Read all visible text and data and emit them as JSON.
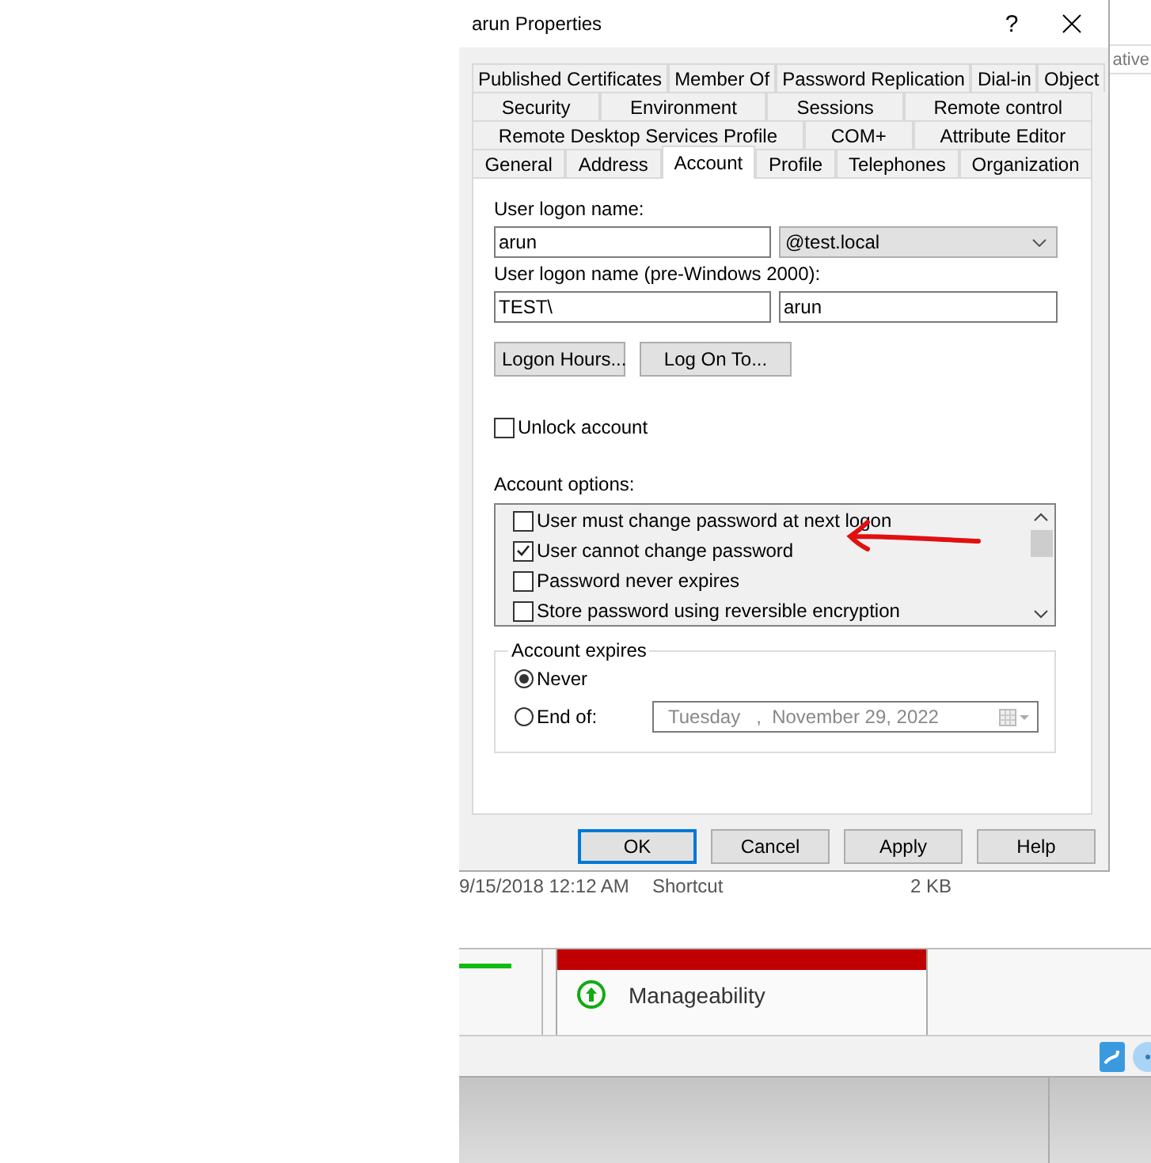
{
  "window": {
    "title": "arun Properties",
    "help": "?"
  },
  "tab_rows": [
    [
      {
        "label": "Published Certificates",
        "selected": false
      },
      {
        "label": "Member Of",
        "selected": false
      },
      {
        "label": "Password Replication",
        "selected": false
      },
      {
        "label": "Dial-in",
        "selected": false
      },
      {
        "label": "Object",
        "selected": false
      }
    ],
    [
      {
        "label": "Security",
        "selected": false
      },
      {
        "label": "Environment",
        "selected": false
      },
      {
        "label": "Sessions",
        "selected": false
      },
      {
        "label": "Remote control",
        "selected": false
      }
    ],
    [
      {
        "label": "Remote Desktop Services Profile",
        "selected": false
      },
      {
        "label": "COM+",
        "selected": false
      },
      {
        "label": "Attribute Editor",
        "selected": false
      }
    ],
    [
      {
        "label": "General",
        "selected": false
      },
      {
        "label": "Address",
        "selected": false
      },
      {
        "label": "Account",
        "selected": true
      },
      {
        "label": "Profile",
        "selected": false
      },
      {
        "label": "Telephones",
        "selected": false
      },
      {
        "label": "Organization",
        "selected": false
      }
    ]
  ],
  "logon_name": {
    "label": "User logon name:",
    "value": "arun",
    "domain": "@test.local"
  },
  "pre2000": {
    "label": "User logon name (pre-Windows 2000):",
    "domain": "TEST\\",
    "value": "arun"
  },
  "logon_buttons": [
    "Logon Hours...",
    "Log On To..."
  ],
  "unlock": {
    "label": "Unlock account",
    "checked": false
  },
  "account_options": {
    "label": "Account options:",
    "items": [
      {
        "label": "User must change password at next logon",
        "checked": false
      },
      {
        "label": "User cannot change password",
        "checked": true
      },
      {
        "label": "Password never expires",
        "checked": false
      },
      {
        "label": "Store password using reversible encryption",
        "checked": false
      }
    ]
  },
  "account_expires": {
    "label": "Account expires",
    "options": [
      {
        "label": "Never",
        "selected": true
      },
      {
        "label": "End of:",
        "selected": false
      }
    ],
    "date": "Tuesday   ,  November 29, 2022",
    "date_disabled": true
  },
  "buttons": [
    {
      "label": "OK",
      "default": true
    },
    {
      "label": "Cancel",
      "default": false
    },
    {
      "label": "Apply",
      "default": false
    },
    {
      "label": "Help",
      "default": false
    }
  ],
  "background": {
    "header_fragment": "ative",
    "file_row": [
      "9/15/2018 12:12 AM",
      "Shortcut",
      "2 KB"
    ],
    "card_item": "Manageability"
  }
}
